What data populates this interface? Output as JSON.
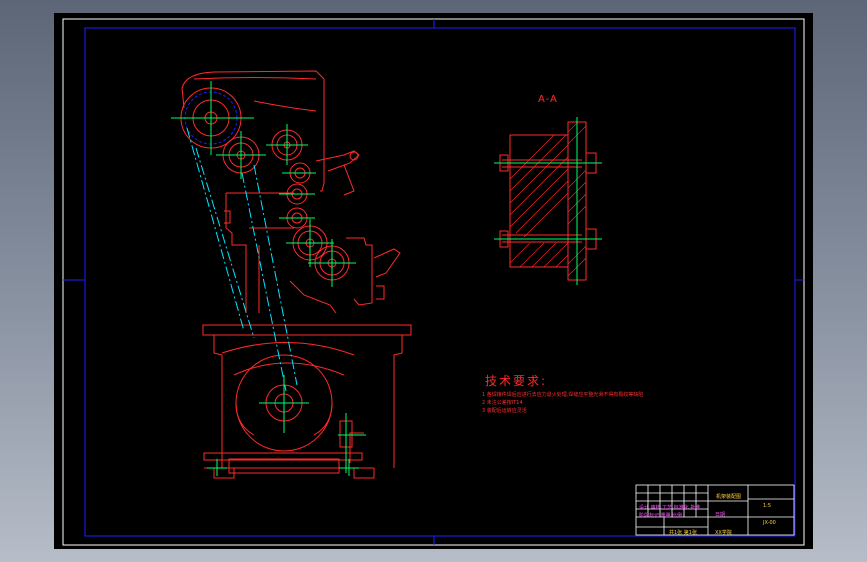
{
  "drawing": {
    "section_label": "A-A",
    "tech_requirements": {
      "title": "技术要求:",
      "items": [
        "1 各焊接件焊后应进行去应力退火处理,焊缝应平整光滑不得有裂纹等缺陷",
        "2 未注公差按IT14",
        "3 装配后运转应灵活"
      ]
    },
    "title_block": {
      "drawing_name": "机架装配图",
      "scale": "1:5",
      "drawing_no": "JX-00",
      "designer_row": "设计 审核 工艺 标准化 批准",
      "stage_row": "阶段标记 重量 比例",
      "sheet_info": "共1张 第1张",
      "school": "XX学院",
      "date": "日期"
    }
  },
  "colors": {
    "background": "#000000",
    "frame": "#1e1eff",
    "outline": "#ff2a2a",
    "center_line": "#00ff66",
    "dimension": "#00e5ff",
    "title_text": "#ffd23a",
    "label_text": "#ff55ff"
  }
}
